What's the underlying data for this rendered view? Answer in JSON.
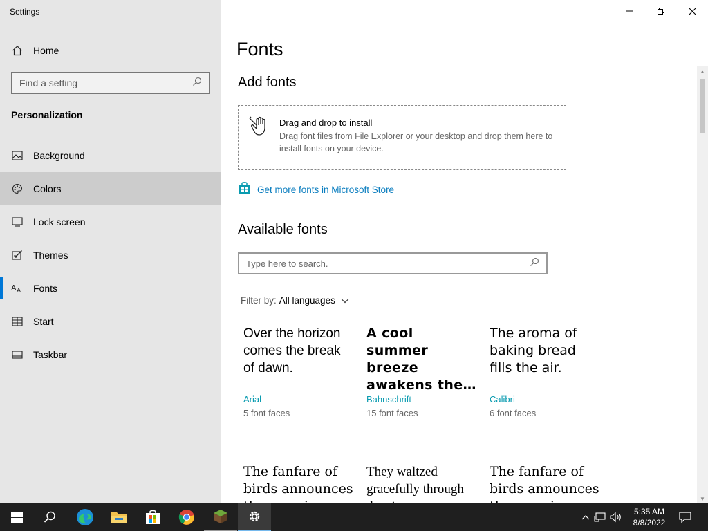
{
  "window": {
    "title": "Settings",
    "controls": {
      "minimize": "minimize",
      "maximize": "restore",
      "close": "close"
    }
  },
  "sidebar": {
    "home_label": "Home",
    "search_placeholder": "Find a setting",
    "section_title": "Personalization",
    "items": [
      {
        "label": "Background",
        "icon": "picture-icon"
      },
      {
        "label": "Colors",
        "icon": "palette-icon"
      },
      {
        "label": "Lock screen",
        "icon": "lock-screen-icon"
      },
      {
        "label": "Themes",
        "icon": "themes-icon"
      },
      {
        "label": "Fonts",
        "icon": "fonts-icon"
      },
      {
        "label": "Start",
        "icon": "start-icon"
      },
      {
        "label": "Taskbar",
        "icon": "taskbar-icon"
      }
    ]
  },
  "main": {
    "title": "Fonts",
    "add_fonts_heading": "Add fonts",
    "dropzone": {
      "title": "Drag and drop to install",
      "description": "Drag font files from File Explorer or your desktop and drop them here to install fonts on your device."
    },
    "store_link": "Get more fonts in Microsoft Store",
    "available_heading": "Available fonts",
    "font_search_placeholder": "Type here to search.",
    "filter_label": "Filter by:",
    "filter_value": "All languages",
    "fonts": [
      {
        "sample": "Over the horizon comes the break of dawn.",
        "name": "Arial",
        "faces": "5 font faces"
      },
      {
        "sample": "A cool summer breeze awakens the…",
        "name": "Bahnschrift",
        "faces": "15 font faces"
      },
      {
        "sample": "The aroma of baking bread fills the air.",
        "name": "Calibri",
        "faces": "6 font faces"
      },
      {
        "sample": "The fanfare of birds announces the morning.",
        "name": "",
        "faces": ""
      },
      {
        "sample": "They waltzed gracefully through the air.",
        "name": "",
        "faces": ""
      },
      {
        "sample": "The fanfare of birds announces the morning.",
        "name": "",
        "faces": ""
      }
    ]
  },
  "taskbar": {
    "apps": [
      "windows-start-icon",
      "search-icon",
      "edge-icon",
      "file-explorer-icon",
      "microsoft-store-icon",
      "chrome-icon",
      "minecraft-icon",
      "settings-gear-icon"
    ],
    "clock_time": "5:35 AM",
    "clock_date": "8/8/2022"
  },
  "colors": {
    "accent": "#0078d7",
    "link": "#0a7dbf",
    "font_name": "#0a9bb0",
    "sidebar_bg": "#e6e6e6",
    "taskbar_bg": "#1f1f1f"
  }
}
